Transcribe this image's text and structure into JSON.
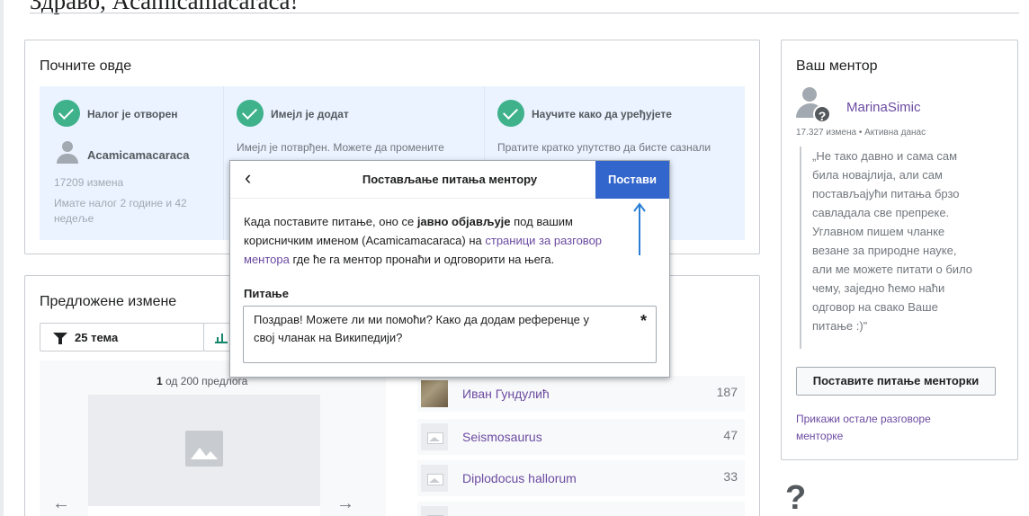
{
  "greeting": "Здраво, Acamicamacaraca!",
  "start": {
    "title": "Почните овде",
    "tasks": [
      {
        "title": "Налог је отворен",
        "desc": "Acamicamacaraca"
      },
      {
        "title": "Имејл је додат",
        "desc": "Имејл је потврђен. Можете да промените"
      },
      {
        "title": "Научите како да уређујете",
        "desc": "Пратите кратко упутство да бисте сазнали"
      }
    ],
    "username": "Acamicamacaraca",
    "edit_count": "17209 измена",
    "account_age_line1": "Имате налог 2 године и 42",
    "account_age_line2": "недеље"
  },
  "suggested": {
    "title": "Предложене измене",
    "filter_label": "25 тема",
    "counter_current": "1",
    "counter_rest": " од 200 предлога",
    "articles": [
      {
        "name": "Иван Гундулић",
        "count": "187"
      },
      {
        "name": "Seismosaurus",
        "count": "47"
      },
      {
        "name": "Diplodocus hallorum",
        "count": "33"
      }
    ]
  },
  "mentor": {
    "title": "Ваш ментор",
    "name": "MarinaSimic",
    "meta": "17.327 измена • Активна данас",
    "quote_lines": [
      "„Не тако давно и сама сам",
      "била новајлија, али сам",
      "постављајући питања брзо",
      "савладала све препреке.",
      "Углавном пишем чланке",
      "везане за природне науке,",
      "али ме можете питати о било",
      "чему, заједно ћемо наћи",
      "одговор на свако Ваше",
      "питање :)\""
    ],
    "ask_button": "Поставите питање менторки",
    "other_link_line1": "Прикажи остале разговоре",
    "other_link_line2": "менторке"
  },
  "dialog": {
    "title": "Постављање питања ментору",
    "post_button": "Постави",
    "body_line1_a": "Када поставите питање, оно се ",
    "body_line1_b": "јавно објављује",
    "body_line1_c": " под вашим",
    "body_line2_a": "корисничким именом (Acamicamacaraca) на ",
    "body_line2_link": "страници за разговор",
    "body_line3_link": "ментора",
    "body_line3_b": " где ће га ментор пронаћи и одговорити на њега.",
    "question_label": "Питање",
    "question_line1": "Поздрав! Можете ли ми помоћи? Како да додам референце у",
    "question_line2": "свој чланак на Википедији?",
    "required_mark": "*"
  },
  "icons": {
    "back": "‹",
    "prev": "←",
    "next": "→",
    "help": "?"
  },
  "colors": {
    "accent": "#3366cc",
    "link": "#6b4ba1",
    "success": "#3fb28c",
    "annotation_arrow": "#2a7fd4"
  }
}
